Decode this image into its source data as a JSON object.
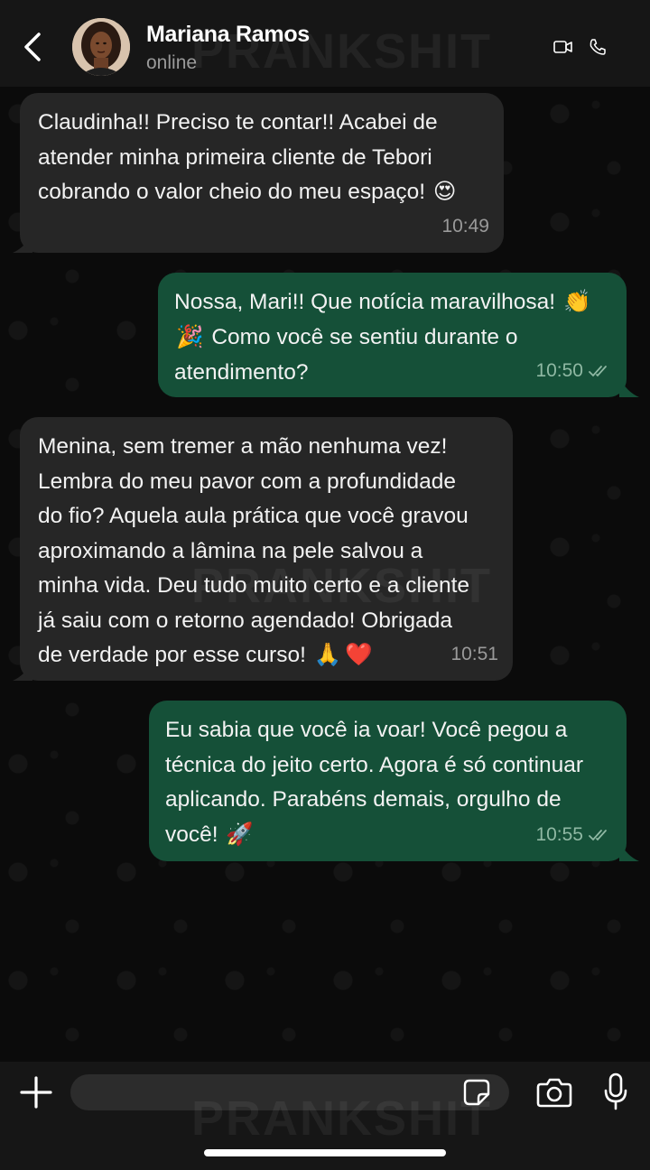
{
  "header": {
    "contact_name": "Mariana Ramos",
    "status": "online",
    "background_color": "#161616"
  },
  "watermark": "PRANKSHIT",
  "messages": [
    {
      "direction": "incoming",
      "line1": "Claudinha!! Preciso te contar!! Acabei de",
      "line2": "atender minha primeira cliente de Tebori",
      "line3": "cobrando o valor cheio do meu espaço!",
      "emoji": "😍",
      "time": "10:49"
    },
    {
      "direction": "outgoing",
      "line1": "Nossa, Mari!! Que notícia maravilhosa!",
      "emoji1": "👏",
      "emoji2": "🎉",
      "line2": "Como você se sentiu durante o",
      "line3": "atendimento?",
      "time": "10:50",
      "read_status": "double-check-icon"
    },
    {
      "direction": "incoming",
      "line1": "Menina, sem tremer a mão nenhuma vez!",
      "line2": "Lembra do meu pavor com a profundidade",
      "line3": "do fio? Aquela aula prática que você gravou",
      "line4": "aproximando a lâmina na pele salvou a",
      "line5": "minha vida. Deu tudo muito certo e a cliente",
      "line6": "já saiu com o retorno agendado! Obrigada",
      "line7": "de verdade por esse curso!",
      "emoji1": "🙏",
      "emoji2": "❤️",
      "time": "10:51"
    },
    {
      "direction": "outgoing",
      "line1": "Eu sabia que você ia voar! Você pegou a",
      "line2": "técnica do jeito certo. Agora é só continuar",
      "line3": "aplicando. Parabéns demais, orgulho de",
      "line4": "você!",
      "emoji": "🚀",
      "time": "10:55",
      "read_status": "double-check-icon"
    }
  ],
  "composer": {
    "placeholder": ""
  },
  "colors": {
    "incoming_bubble": "#262626",
    "outgoing_bubble": "#155038",
    "chat_background": "#0b0b0b"
  }
}
